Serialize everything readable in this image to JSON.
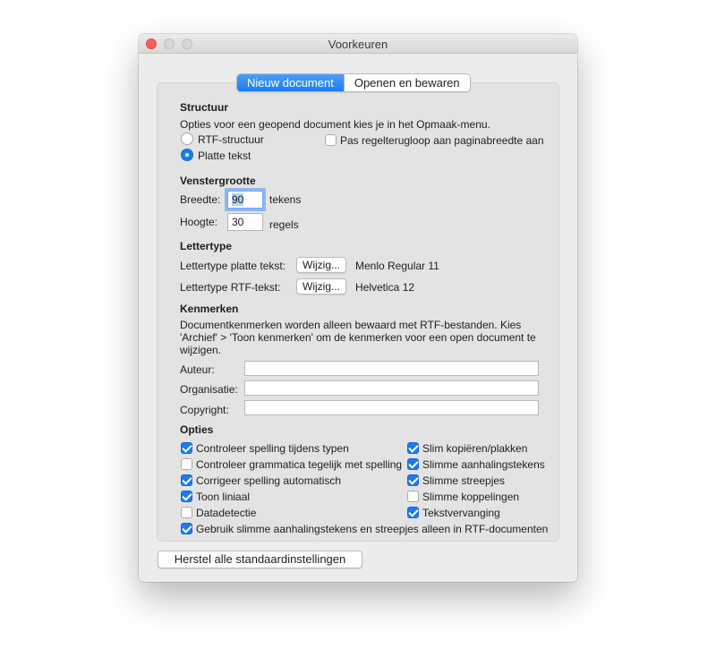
{
  "window": {
    "title": "Voorkeuren"
  },
  "tabs": [
    {
      "label": "Nieuw document",
      "active": true
    },
    {
      "label": "Openen en bewaren",
      "active": false
    }
  ],
  "structure": {
    "title": "Structuur",
    "description": "Opties voor een geopend document kies je in het Opmaak-menu.",
    "options": [
      {
        "label": "RTF-structuur",
        "selected": false
      },
      {
        "label": "Platte tekst",
        "selected": true
      }
    ],
    "wrap_checkbox": {
      "label": "Pas regelterugloop aan paginabreedte aan",
      "checked": false
    }
  },
  "window_size": {
    "title": "Venstergrootte",
    "width_label": "Breedte:",
    "width_value": "90",
    "width_unit": "tekens",
    "height_label": "Hoogte:",
    "height_value": "30",
    "height_unit": "regels"
  },
  "font": {
    "title": "Lettertype",
    "plain_label": "Lettertype platte tekst:",
    "plain_button": "Wijzig...",
    "plain_value": "Menlo Regular 11",
    "rtf_label": "Lettertype RTF-tekst:",
    "rtf_button": "Wijzig...",
    "rtf_value": "Helvetica 12"
  },
  "properties": {
    "title": "Kenmerken",
    "description_lines": [
      "Documentkenmerken worden alleen bewaard met RTF-bestanden. Kies",
      "'Archief' > 'Toon kenmerken' om de kenmerken voor een open document te",
      "wijzigen."
    ],
    "fields": [
      {
        "label": "Auteur:",
        "value": ""
      },
      {
        "label": "Organisatie:",
        "value": ""
      },
      {
        "label": "Copyright:",
        "value": ""
      }
    ]
  },
  "options": {
    "title": "Opties",
    "left": [
      {
        "label": "Controleer spelling tijdens typen",
        "checked": true
      },
      {
        "label": "Controleer grammatica tegelijk met spelling",
        "checked": false
      },
      {
        "label": "Corrigeer spelling automatisch",
        "checked": true
      },
      {
        "label": "Toon liniaal",
        "checked": true
      },
      {
        "label": "Datadetectie",
        "checked": false
      }
    ],
    "right": [
      {
        "label": "Slim kopiëren/plakken",
        "checked": true
      },
      {
        "label": "Slimme aanhalingstekens",
        "checked": true
      },
      {
        "label": "Slimme streepjes",
        "checked": true
      },
      {
        "label": "Slimme koppelingen",
        "checked": false
      },
      {
        "label": "Tekstvervanging",
        "checked": true
      }
    ],
    "bottom": {
      "label": "Gebruik slimme aanhalingstekens en streepjes alleen in RTF-documenten",
      "checked": true
    }
  },
  "restore_button": "Herstel alle standaardinstellingen",
  "colors": {
    "accent": "#1b7cf2",
    "close": "#fc605b"
  }
}
